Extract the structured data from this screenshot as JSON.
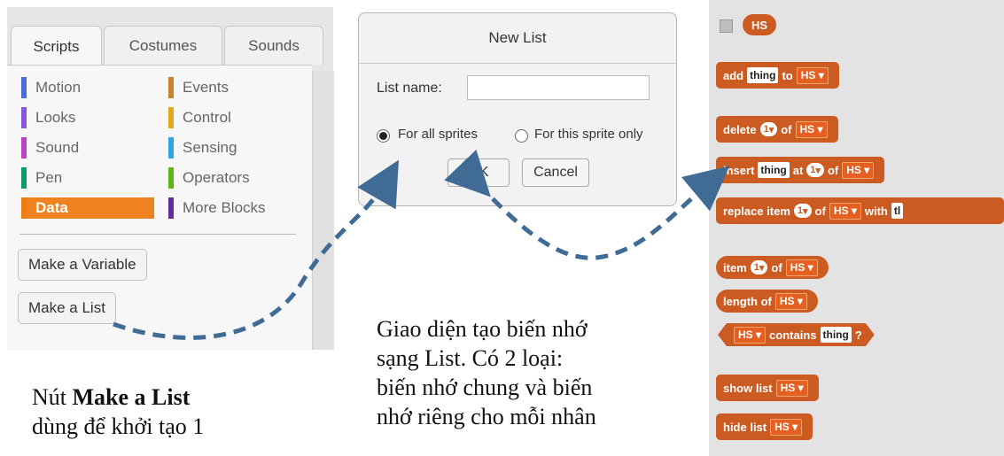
{
  "tabs": [
    "Scripts",
    "Costumes",
    "Sounds"
  ],
  "categories_left": [
    {
      "label": "Motion",
      "color": "#4a6cd4"
    },
    {
      "label": "Looks",
      "color": "#8a55d7"
    },
    {
      "label": "Sound",
      "color": "#bb42c3"
    },
    {
      "label": "Pen",
      "color": "#0e9a6c"
    },
    {
      "label": "Data",
      "color": "#ee7d16"
    }
  ],
  "categories_right": [
    {
      "label": "Events",
      "color": "#c88330"
    },
    {
      "label": "Control",
      "color": "#e1a91a"
    },
    {
      "label": "Sensing",
      "color": "#2ca5e2"
    },
    {
      "label": "Operators",
      "color": "#5cb712"
    },
    {
      "label": "More Blocks",
      "color": "#632d99"
    }
  ],
  "buttons": {
    "make_variable": "Make a Variable",
    "make_list": "Make a List"
  },
  "dialog": {
    "title": "New List",
    "name_label": "List name:",
    "name_value": "",
    "radio_all": "For all sprites",
    "radio_this": "For this sprite only",
    "ok": "OK",
    "cancel": "Cancel"
  },
  "captions": {
    "left_prefix": "Nút ",
    "left_bold": "Make a List",
    "left_line2": "dùng để khởi tạo 1",
    "middle_lines": [
      "Giao diện tạo biến nhớ",
      "sạng List. Có 2 loại:",
      "biến nhớ chung và biến",
      "nhớ riêng cho mỗi nhân"
    ]
  },
  "blocks": {
    "list_name": "HS",
    "thing": "thing",
    "one": "1",
    "add": "add",
    "to": "to",
    "delete": "delete",
    "of": "of",
    "insert": "insert",
    "at": "at",
    "replace_item": "replace item",
    "with": "with",
    "with_cut": "tl",
    "item": "item",
    "length_of": "length of",
    "contains": "contains",
    "q": "?",
    "show_list": "show list",
    "hide_list": "hide list"
  },
  "colors": {
    "data_block": "#cc5b22",
    "arrow": "#3f6b95",
    "selected_category": "#f0811f"
  }
}
